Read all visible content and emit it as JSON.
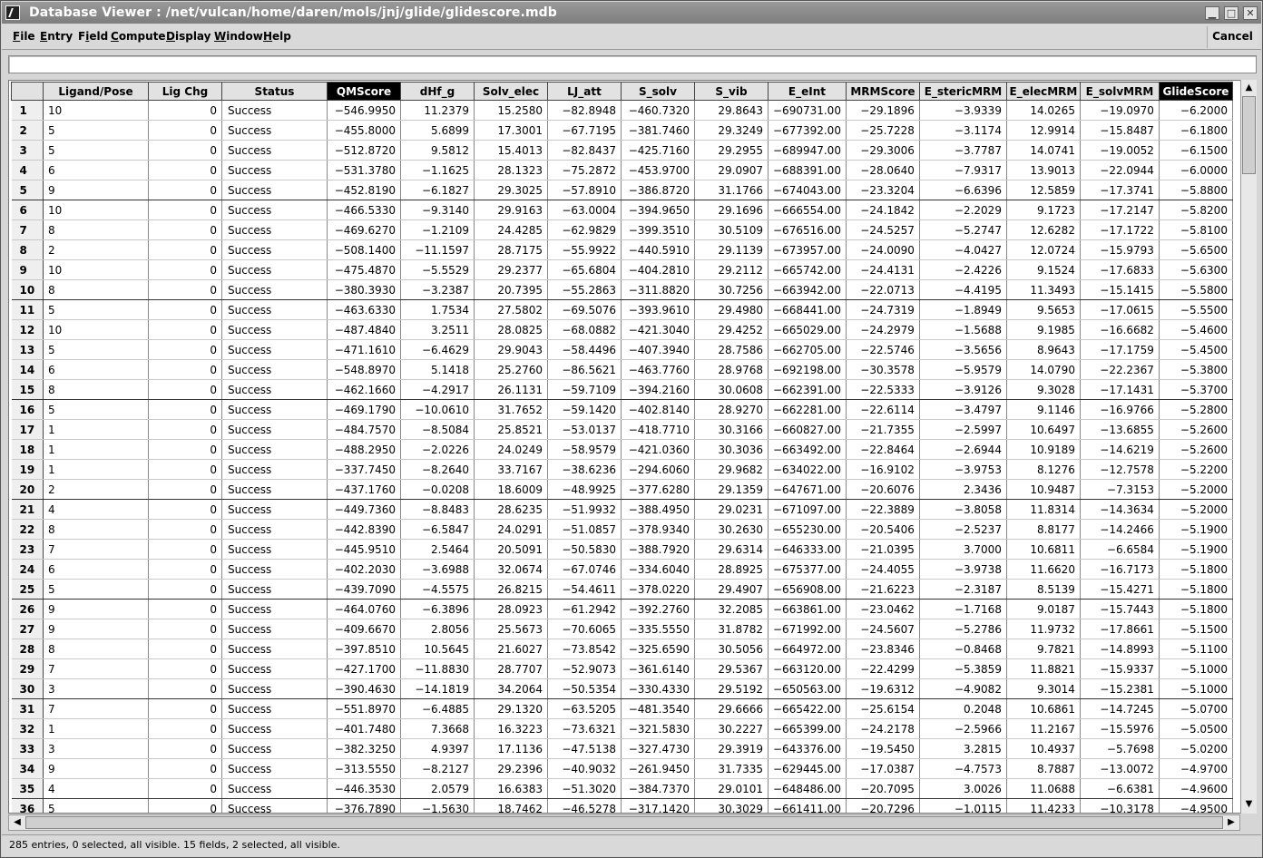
{
  "window": {
    "title": "Database Viewer : /net/vulcan/home/daren/mols/jnj/glide/glidescore.mdb",
    "minimize_glyph": "▁",
    "maximize_glyph": "□",
    "close_glyph": "✕"
  },
  "menubar": {
    "items": [
      {
        "label": "File",
        "mnemonic": "F"
      },
      {
        "label": "Entry",
        "mnemonic": "E"
      },
      {
        "label": "Field",
        "mnemonic": "i"
      },
      {
        "label": "Compute",
        "mnemonic": "C"
      },
      {
        "label": "Display",
        "mnemonic": "D"
      },
      {
        "label": "Window",
        "mnemonic": "W"
      },
      {
        "label": "Help",
        "mnemonic": "H"
      }
    ],
    "cancel_label": "Cancel"
  },
  "command_field": {
    "value": ""
  },
  "table": {
    "columns": [
      {
        "label": "",
        "selected": false
      },
      {
        "label": "Ligand/Pose",
        "selected": false
      },
      {
        "label": "Lig Chg",
        "selected": false
      },
      {
        "label": "Status",
        "selected": false
      },
      {
        "label": "QMScore",
        "selected": true
      },
      {
        "label": "dHf_g",
        "selected": false
      },
      {
        "label": "Solv_elec",
        "selected": false
      },
      {
        "label": "LJ_att",
        "selected": false
      },
      {
        "label": "S_solv",
        "selected": false
      },
      {
        "label": "S_vib",
        "selected": false
      },
      {
        "label": "E_eInt",
        "selected": false
      },
      {
        "label": "MRMScore",
        "selected": false
      },
      {
        "label": "E_stericMRM",
        "selected": false
      },
      {
        "label": "E_elecMRM",
        "selected": false
      },
      {
        "label": "E_solvMRM",
        "selected": false
      },
      {
        "label": "GlideScore",
        "selected": true
      }
    ],
    "rows": [
      [
        "1",
        "10",
        "0",
        "Success",
        "−546.9950",
        "11.2379",
        "15.2580",
        "−82.8948",
        "−460.7320",
        "29.8643",
        "−690731.00",
        "−29.1896",
        "−3.9339",
        "14.0265",
        "−19.0970",
        "−6.2000"
      ],
      [
        "2",
        "5",
        "0",
        "Success",
        "−455.8000",
        "5.6899",
        "17.3001",
        "−67.7195",
        "−381.7460",
        "29.3249",
        "−677392.00",
        "−25.7228",
        "−3.1174",
        "12.9914",
        "−15.8487",
        "−6.1800"
      ],
      [
        "3",
        "5",
        "0",
        "Success",
        "−512.8720",
        "9.5812",
        "15.4013",
        "−82.8437",
        "−425.7160",
        "29.2955",
        "−689947.00",
        "−29.3006",
        "−3.7787",
        "14.0741",
        "−19.0052",
        "−6.1500"
      ],
      [
        "4",
        "6",
        "0",
        "Success",
        "−531.3780",
        "−1.1625",
        "28.1323",
        "−75.2872",
        "−453.9700",
        "29.0907",
        "−688391.00",
        "−28.0640",
        "−7.9317",
        "13.9013",
        "−22.0944",
        "−6.0000"
      ],
      [
        "5",
        "9",
        "0",
        "Success",
        "−452.8190",
        "−6.1827",
        "29.3025",
        "−57.8910",
        "−386.8720",
        "31.1766",
        "−674043.00",
        "−23.3204",
        "−6.6396",
        "12.5859",
        "−17.3741",
        "−5.8800"
      ],
      [
        "6",
        "10",
        "0",
        "Success",
        "−466.5330",
        "−9.3140",
        "29.9163",
        "−63.0004",
        "−394.9650",
        "29.1696",
        "−666554.00",
        "−24.1842",
        "−2.2029",
        "9.1723",
        "−17.2147",
        "−5.8200"
      ],
      [
        "7",
        "8",
        "0",
        "Success",
        "−469.6270",
        "−1.2109",
        "24.4285",
        "−62.9829",
        "−399.3510",
        "30.5109",
        "−676516.00",
        "−24.5257",
        "−5.2747",
        "12.6282",
        "−17.1722",
        "−5.8100"
      ],
      [
        "8",
        "2",
        "0",
        "Success",
        "−508.1400",
        "−11.1597",
        "28.7175",
        "−55.9922",
        "−440.5910",
        "29.1139",
        "−673957.00",
        "−24.0090",
        "−4.0427",
        "12.0724",
        "−15.9793",
        "−5.6500"
      ],
      [
        "9",
        "10",
        "0",
        "Success",
        "−475.4870",
        "−5.5529",
        "29.2377",
        "−65.6804",
        "−404.2810",
        "29.2112",
        "−665742.00",
        "−24.4131",
        "−2.4226",
        "9.1524",
        "−17.6833",
        "−5.6300"
      ],
      [
        "10",
        "8",
        "0",
        "Success",
        "−380.3930",
        "−3.2387",
        "20.7395",
        "−55.2863",
        "−311.8820",
        "30.7256",
        "−663942.00",
        "−22.0713",
        "−4.4195",
        "11.3493",
        "−15.1415",
        "−5.5800"
      ],
      [
        "11",
        "5",
        "0",
        "Success",
        "−463.6330",
        "1.7534",
        "27.5802",
        "−69.5076",
        "−393.9610",
        "29.4980",
        "−668441.00",
        "−24.7319",
        "−1.8949",
        "9.5653",
        "−17.0615",
        "−5.5500"
      ],
      [
        "12",
        "10",
        "0",
        "Success",
        "−487.4840",
        "3.2511",
        "28.0825",
        "−68.0882",
        "−421.3040",
        "29.4252",
        "−665029.00",
        "−24.2979",
        "−1.5688",
        "9.1985",
        "−16.6682",
        "−5.4600"
      ],
      [
        "13",
        "5",
        "0",
        "Success",
        "−471.1610",
        "−6.4629",
        "29.9043",
        "−58.4496",
        "−407.3940",
        "28.7586",
        "−662705.00",
        "−22.5746",
        "−3.5656",
        "8.9643",
        "−17.1759",
        "−5.4500"
      ],
      [
        "14",
        "6",
        "0",
        "Success",
        "−548.8970",
        "5.1418",
        "25.2760",
        "−86.5621",
        "−463.7760",
        "28.9768",
        "−692198.00",
        "−30.3578",
        "−5.9579",
        "14.0790",
        "−22.2367",
        "−5.3800"
      ],
      [
        "15",
        "8",
        "0",
        "Success",
        "−462.1660",
        "−4.2917",
        "26.1131",
        "−59.7109",
        "−394.2160",
        "30.0608",
        "−662391.00",
        "−22.5333",
        "−3.9126",
        "9.3028",
        "−17.1431",
        "−5.3700"
      ],
      [
        "16",
        "5",
        "0",
        "Success",
        "−469.1790",
        "−10.0610",
        "31.7652",
        "−59.1420",
        "−402.8140",
        "28.9270",
        "−662281.00",
        "−22.6114",
        "−3.4797",
        "9.1146",
        "−16.9766",
        "−5.2800"
      ],
      [
        "17",
        "1",
        "0",
        "Success",
        "−484.7570",
        "−8.5084",
        "25.8521",
        "−53.0137",
        "−418.7710",
        "30.3166",
        "−660827.00",
        "−21.7355",
        "−2.5997",
        "10.6497",
        "−13.6855",
        "−5.2600"
      ],
      [
        "18",
        "1",
        "0",
        "Success",
        "−488.2950",
        "−2.0226",
        "24.0249",
        "−58.9579",
        "−421.0360",
        "30.3036",
        "−663492.00",
        "−22.8464",
        "−2.6944",
        "10.9189",
        "−14.6219",
        "−5.2600"
      ],
      [
        "19",
        "1",
        "0",
        "Success",
        "−337.7450",
        "−8.2640",
        "33.7167",
        "−38.6236",
        "−294.6060",
        "29.9682",
        "−634022.00",
        "−16.9102",
        "−3.9753",
        "8.1276",
        "−12.7578",
        "−5.2200"
      ],
      [
        "20",
        "2",
        "0",
        "Success",
        "−437.1760",
        "−0.0208",
        "18.6009",
        "−48.9925",
        "−377.6280",
        "29.1359",
        "−647671.00",
        "−20.6076",
        "2.3436",
        "10.9487",
        "−7.3153",
        "−5.2000"
      ],
      [
        "21",
        "4",
        "0",
        "Success",
        "−449.7360",
        "−8.8483",
        "28.6235",
        "−51.9932",
        "−388.4950",
        "29.0231",
        "−671097.00",
        "−22.3889",
        "−3.8058",
        "11.8314",
        "−14.3634",
        "−5.2000"
      ],
      [
        "22",
        "8",
        "0",
        "Success",
        "−442.8390",
        "−6.5847",
        "24.0291",
        "−51.0857",
        "−378.9340",
        "30.2630",
        "−655230.00",
        "−20.5406",
        "−2.5237",
        "8.8177",
        "−14.2466",
        "−5.1900"
      ],
      [
        "23",
        "7",
        "0",
        "Success",
        "−445.9510",
        "2.5464",
        "20.5091",
        "−50.5830",
        "−388.7920",
        "29.6314",
        "−646333.00",
        "−21.0395",
        "3.7000",
        "10.6811",
        "−6.6584",
        "−5.1900"
      ],
      [
        "24",
        "6",
        "0",
        "Success",
        "−402.2030",
        "−3.6988",
        "32.0674",
        "−67.0746",
        "−334.6040",
        "28.8925",
        "−675377.00",
        "−24.4055",
        "−3.9738",
        "11.6620",
        "−16.7173",
        "−5.1800"
      ],
      [
        "25",
        "5",
        "0",
        "Success",
        "−439.7090",
        "−4.5575",
        "26.8215",
        "−54.4611",
        "−378.0220",
        "29.4907",
        "−656908.00",
        "−21.6223",
        "−2.3187",
        "8.5139",
        "−15.4271",
        "−5.1800"
      ],
      [
        "26",
        "9",
        "0",
        "Success",
        "−464.0760",
        "−6.3896",
        "28.0923",
        "−61.2942",
        "−392.2760",
        "32.2085",
        "−663861.00",
        "−23.0462",
        "−1.7168",
        "9.0187",
        "−15.7443",
        "−5.1800"
      ],
      [
        "27",
        "9",
        "0",
        "Success",
        "−409.6670",
        "2.8056",
        "25.5673",
        "−70.6065",
        "−335.5550",
        "31.8782",
        "−671992.00",
        "−24.5607",
        "−5.2786",
        "11.9732",
        "−17.8661",
        "−5.1500"
      ],
      [
        "28",
        "8",
        "0",
        "Success",
        "−397.8510",
        "10.5645",
        "21.6027",
        "−73.8542",
        "−325.6590",
        "30.5056",
        "−664972.00",
        "−23.8346",
        "−0.8468",
        "9.7821",
        "−14.8993",
        "−5.1100"
      ],
      [
        "29",
        "7",
        "0",
        "Success",
        "−427.1700",
        "−11.8830",
        "28.7707",
        "−52.9073",
        "−361.6140",
        "29.5367",
        "−663120.00",
        "−22.4299",
        "−5.3859",
        "11.8821",
        "−15.9337",
        "−5.1000"
      ],
      [
        "30",
        "3",
        "0",
        "Success",
        "−390.4630",
        "−14.1819",
        "34.2064",
        "−50.5354",
        "−330.4330",
        "29.5192",
        "−650563.00",
        "−19.6312",
        "−4.9082",
        "9.3014",
        "−15.2381",
        "−5.1000"
      ],
      [
        "31",
        "7",
        "0",
        "Success",
        "−551.8970",
        "−6.4885",
        "29.1320",
        "−63.5205",
        "−481.3540",
        "29.6666",
        "−665422.00",
        "−25.6154",
        "0.2048",
        "10.6861",
        "−14.7245",
        "−5.0700"
      ],
      [
        "32",
        "1",
        "0",
        "Success",
        "−401.7480",
        "7.3668",
        "16.3223",
        "−73.6321",
        "−321.5830",
        "30.2227",
        "−665399.00",
        "−24.2178",
        "−2.5966",
        "11.2167",
        "−15.5976",
        "−5.0500"
      ],
      [
        "33",
        "3",
        "0",
        "Success",
        "−382.3250",
        "4.9397",
        "17.1136",
        "−47.5138",
        "−327.4730",
        "29.3919",
        "−643376.00",
        "−19.5450",
        "3.2815",
        "10.4937",
        "−5.7698",
        "−5.0200"
      ],
      [
        "34",
        "9",
        "0",
        "Success",
        "−313.5550",
        "−8.2127",
        "29.2396",
        "−40.9032",
        "−261.9450",
        "31.7335",
        "−629445.00",
        "−17.0387",
        "−4.7573",
        "8.7887",
        "−13.0072",
        "−4.9700"
      ],
      [
        "35",
        "4",
        "0",
        "Success",
        "−446.3530",
        "2.0579",
        "16.6383",
        "−51.3020",
        "−384.7370",
        "29.0101",
        "−648486.00",
        "−20.7095",
        "3.0026",
        "11.0688",
        "−6.6381",
        "−4.9600"
      ],
      [
        "36",
        "5",
        "0",
        "Success",
        "−376.7890",
        "−1.5630",
        "18.7462",
        "−46.5278",
        "−317.1420",
        "30.3029",
        "−661411.00",
        "−20.7296",
        "−1.0115",
        "11.4233",
        "−10.3178",
        "−4.9500"
      ]
    ]
  },
  "scrollbars": {
    "up": "▲",
    "down": "▼",
    "left": "◀",
    "right": "▶"
  },
  "status": "285 entries, 0 selected, all visible. 15 fields, 2 selected, all visible."
}
